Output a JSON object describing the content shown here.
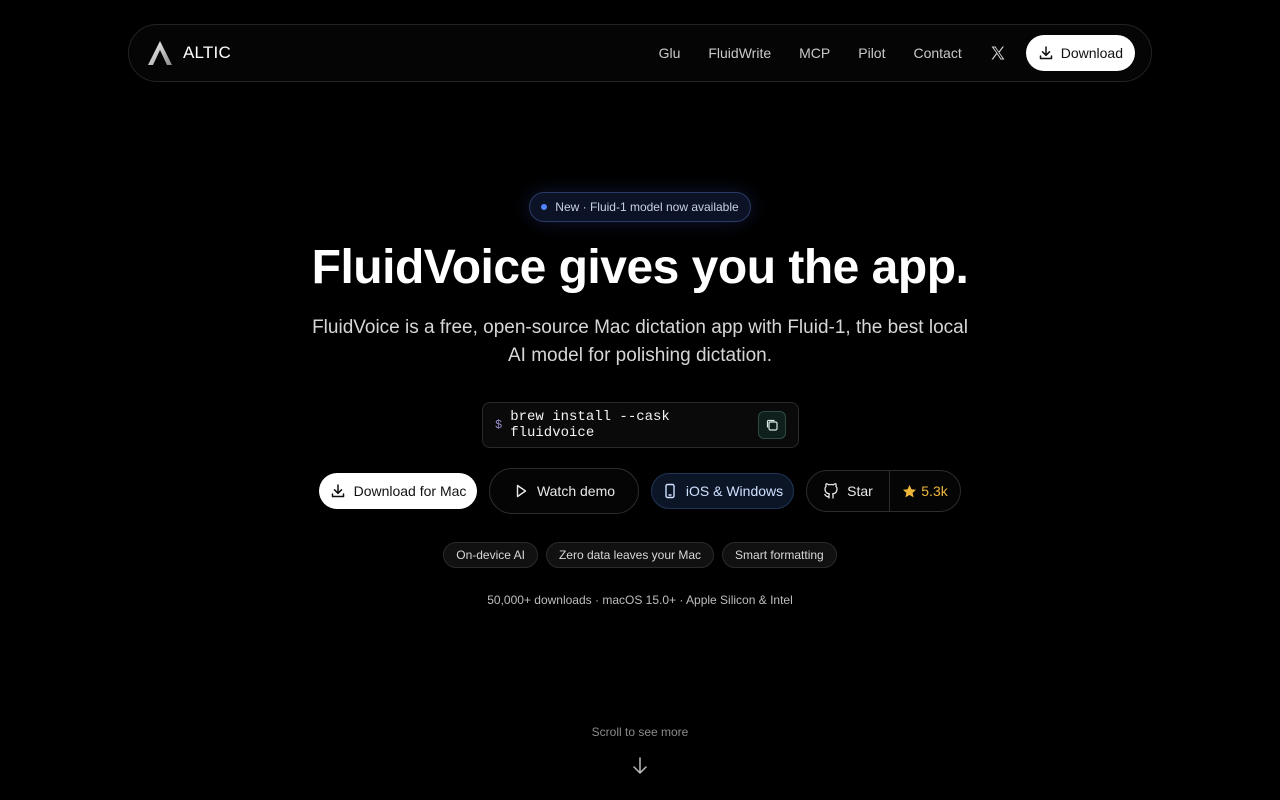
{
  "nav": {
    "brand": "ALTIC",
    "links": [
      "Glu",
      "FluidWrite",
      "MCP",
      "Pilot",
      "Contact"
    ],
    "download_label": "Download"
  },
  "hero": {
    "badge": "New · Fluid-1 model now available",
    "title": "FluidVoice gives you the app.",
    "subtitle": "FluidVoice is a free, open-source Mac dictation app with Fluid-1, the best local AI model for polishing dictation."
  },
  "install": {
    "prompt": "$",
    "command": "brew install --cask fluidvoice"
  },
  "actions": {
    "download_mac": "Download for Mac",
    "watch_demo": "Watch demo",
    "ios_windows": "iOS & Windows",
    "star": "Star",
    "star_count": "5.3k"
  },
  "features": [
    "On-device AI",
    "Zero data leaves your Mac",
    "Smart formatting"
  ],
  "stats": "50,000+ downloads · macOS 15.0+ · Apple Silicon & Intel",
  "scroll_hint": "Scroll to see more",
  "colors": {
    "background": "#000000",
    "badge_dot": "#4f86ff",
    "star_accent": "#f0b63a"
  },
  "icons": {
    "brand": "altic-logo-icon",
    "social": "x-twitter-icon",
    "download": "download-icon",
    "copy": "copy-icon",
    "play": "play-icon",
    "device": "phone-icon",
    "github": "github-icon",
    "star": "star-icon",
    "scroll": "arrow-down-icon"
  }
}
